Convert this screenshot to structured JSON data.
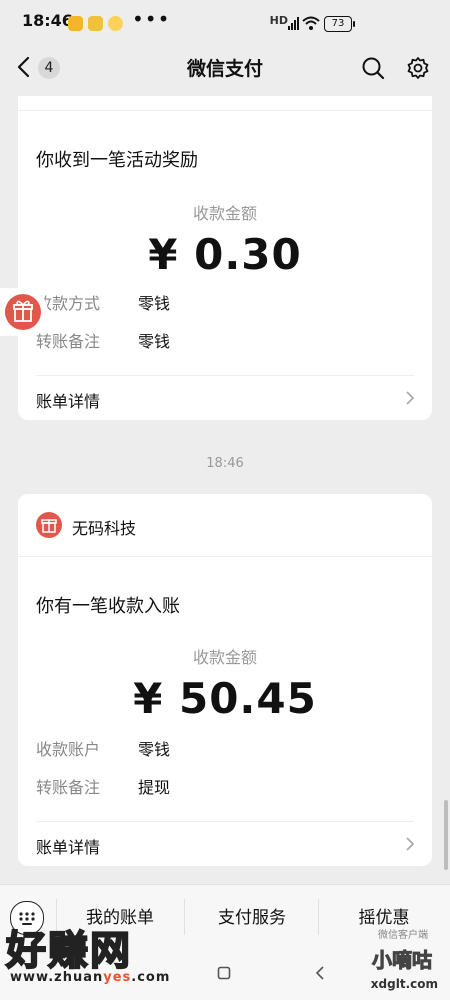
{
  "status_bar": {
    "time": "18:46",
    "dots": "•••",
    "signal_text": "HD",
    "battery": "73"
  },
  "nav": {
    "back_count": "4",
    "title": "微信支付"
  },
  "card1": {
    "heading": "你收到一笔活动奖励",
    "amount_label": "收款金额",
    "amount": "¥ 0.30",
    "rows": [
      {
        "label": "收款方式",
        "value": "零钱"
      },
      {
        "label": "转账备注",
        "value": "零钱"
      }
    ],
    "detail_label": "账单详情"
  },
  "timestamp": "18:46",
  "card2": {
    "merchant": "无码科技",
    "heading": "你有一笔收款入账",
    "amount_label": "收款金额",
    "amount": "¥ 50.45",
    "rows": [
      {
        "label": "收款账户",
        "value": "零钱"
      },
      {
        "label": "转账备注",
        "value": "提现"
      }
    ],
    "detail_label": "账单详情"
  },
  "tabbar": {
    "tabs": [
      "我的账单",
      "支付服务",
      "摇优惠"
    ]
  },
  "watermark": {
    "big": "好赚网",
    "url_prefix": "www.zhuan",
    "url_highlight": "yes",
    "url_suffix": ".com",
    "right_small": "微信客户端",
    "right_big": "小嘀咕",
    "right_url": "xdglt.com"
  },
  "colors": {
    "accent_red": "#e2574c",
    "background": "#ededed",
    "card": "#ffffff",
    "watermark_orange": "#e8542f"
  },
  "icons": [
    "back-arrow-icon",
    "search-icon",
    "settings-gear-icon",
    "gift-icon",
    "keyboard-icon",
    "chevron-right-icon",
    "wifi-icon",
    "battery-icon"
  ]
}
